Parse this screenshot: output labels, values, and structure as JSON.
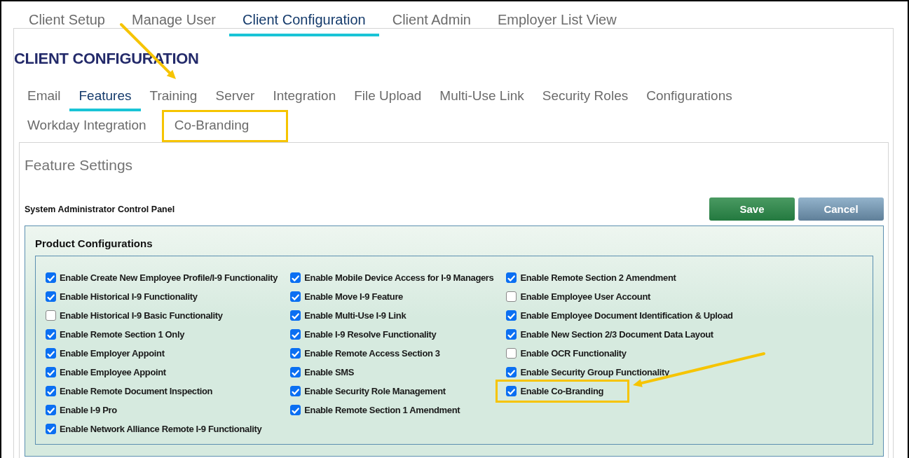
{
  "top_tabs": [
    {
      "label": "Client Setup",
      "selected": false
    },
    {
      "label": "Manage User",
      "selected": false
    },
    {
      "label": "Client Configuration",
      "selected": true
    },
    {
      "label": "Client Admin",
      "selected": false
    },
    {
      "label": "Employer List View",
      "selected": false
    }
  ],
  "heading": "CLIENT CONFIGURATION",
  "sub_tab_rows": [
    [
      {
        "label": "Email",
        "selected": false,
        "highlighted": false
      },
      {
        "label": "Features",
        "selected": true,
        "highlighted": false
      },
      {
        "label": "Training",
        "selected": false,
        "highlighted": false
      },
      {
        "label": "Server",
        "selected": false,
        "highlighted": false
      },
      {
        "label": "Integration",
        "selected": false,
        "highlighted": false
      },
      {
        "label": "File Upload",
        "selected": false,
        "highlighted": false
      },
      {
        "label": "Multi-Use Link",
        "selected": false,
        "highlighted": false
      },
      {
        "label": "Security Roles",
        "selected": false,
        "highlighted": false
      },
      {
        "label": "Configurations",
        "selected": false,
        "highlighted": false
      }
    ],
    [
      {
        "label": "Workday Integration",
        "selected": false,
        "highlighted": false
      },
      {
        "label": "Co-Branding",
        "selected": false,
        "highlighted": true
      }
    ]
  ],
  "section_title": "Feature Settings",
  "panel_title": "System Administrator Control Panel",
  "buttons": [
    {
      "label": "Save",
      "kind": "primary"
    },
    {
      "label": "Cancel",
      "kind": "secondary"
    }
  ],
  "group_title": "Product Configurations",
  "columns": [
    [
      {
        "label": "Enable Create New Employee Profile/I-9 Functionality",
        "checked": true,
        "highlighted": false
      },
      {
        "label": "Enable Historical I-9 Functionality",
        "checked": true,
        "highlighted": false
      },
      {
        "label": "Enable Historical I-9 Basic Functionality",
        "checked": false,
        "highlighted": false
      },
      {
        "label": "Enable Remote Section 1 Only",
        "checked": true,
        "highlighted": false
      },
      {
        "label": "Enable Employer Appoint",
        "checked": true,
        "highlighted": false
      },
      {
        "label": "Enable Employee Appoint",
        "checked": true,
        "highlighted": false
      },
      {
        "label": "Enable Remote Document Inspection",
        "checked": true,
        "highlighted": false
      },
      {
        "label": "Enable I-9 Pro",
        "checked": true,
        "highlighted": false
      },
      {
        "label": "Enable Network Alliance Remote I-9 Functionality",
        "checked": true,
        "highlighted": false
      }
    ],
    [
      {
        "label": "Enable Mobile Device Access for I-9 Managers",
        "checked": true,
        "highlighted": false
      },
      {
        "label": "Enable Move I-9 Feature",
        "checked": true,
        "highlighted": false
      },
      {
        "label": "Enable Multi-Use I-9 Link",
        "checked": true,
        "highlighted": false
      },
      {
        "label": "Enable I-9 Resolve Functionality",
        "checked": true,
        "highlighted": false
      },
      {
        "label": "Enable Remote Access Section 3",
        "checked": true,
        "highlighted": false
      },
      {
        "label": "Enable SMS",
        "checked": true,
        "highlighted": false
      },
      {
        "label": "Enable Security Role Management",
        "checked": true,
        "highlighted": false
      },
      {
        "label": "Enable Remote Section 1 Amendment",
        "checked": true,
        "highlighted": false
      }
    ],
    [
      {
        "label": "Enable Remote Section 2 Amendment",
        "checked": true,
        "highlighted": false
      },
      {
        "label": "Enable Employee User Account",
        "checked": false,
        "highlighted": false
      },
      {
        "label": "Enable Employee Document Identification & Upload",
        "checked": true,
        "highlighted": false
      },
      {
        "label": "Enable New Section 2/3 Document Data Layout",
        "checked": true,
        "highlighted": false
      },
      {
        "label": "Enable OCR Functionality",
        "checked": false,
        "highlighted": false
      },
      {
        "label": "Enable Security Group Functionality",
        "checked": true,
        "highlighted": false
      },
      {
        "label": "Enable Co-Branding",
        "checked": true,
        "highlighted": true
      }
    ]
  ]
}
